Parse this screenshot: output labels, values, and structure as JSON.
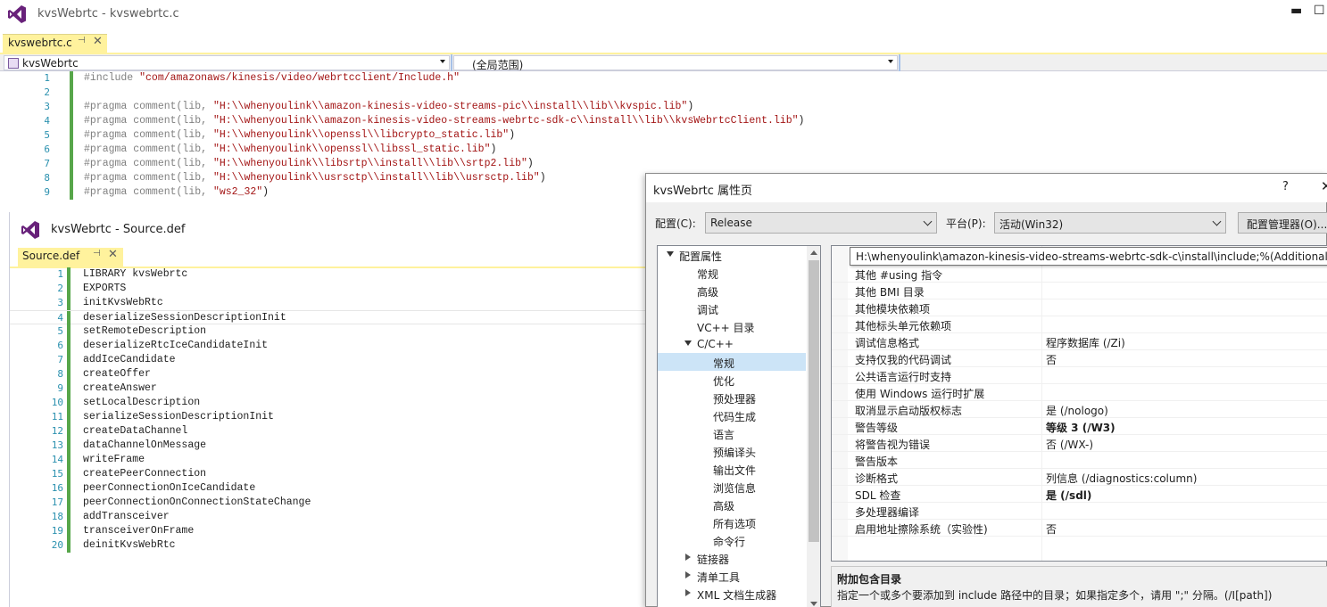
{
  "main_window": {
    "title": "kvsWebrtc - kvswebrtc.c",
    "tab_label": "kvswebrtc.c",
    "pin_glyph": "⊣",
    "close_glyph": "✕",
    "minimize_glyph": "▬",
    "maximize_glyph": "☐",
    "nav_project": "kvsWebrtc",
    "nav_scope": "(全局范围)"
  },
  "editor": {
    "lines": [
      {
        "n": "1",
        "pre": "#include ",
        "str": "\"com/amazonaws/kinesis/video/webrtcclient/Include.h\"",
        "post": ""
      },
      {
        "n": "2",
        "pre": "",
        "str": "",
        "post": ""
      },
      {
        "n": "3",
        "pre": "#pragma comment(lib, ",
        "str": "\"H:\\\\whenyoulink\\\\amazon-kinesis-video-streams-pic\\\\install\\\\lib\\\\kvspic.lib\"",
        "post": ")"
      },
      {
        "n": "4",
        "pre": "#pragma comment(lib, ",
        "str": "\"H:\\\\whenyoulink\\\\amazon-kinesis-video-streams-webrtc-sdk-c\\\\install\\\\lib\\\\kvsWebrtcClient.lib\"",
        "post": ")"
      },
      {
        "n": "5",
        "pre": "#pragma comment(lib, ",
        "str": "\"H:\\\\whenyoulink\\\\openssl\\\\libcrypto_static.lib\"",
        "post": ")"
      },
      {
        "n": "6",
        "pre": "#pragma comment(lib, ",
        "str": "\"H:\\\\whenyoulink\\\\openssl\\\\libssl_static.lib\"",
        "post": ")"
      },
      {
        "n": "7",
        "pre": "#pragma comment(lib, ",
        "str": "\"H:\\\\whenyoulink\\\\libsrtp\\\\install\\\\lib\\\\srtp2.lib\"",
        "post": ")"
      },
      {
        "n": "8",
        "pre": "#pragma comment(lib, ",
        "str": "\"H:\\\\whenyoulink\\\\usrsctp\\\\install\\\\lib\\\\usrsctp.lib\"",
        "post": ")"
      },
      {
        "n": "9",
        "pre": "#pragma comment(lib, ",
        "str": "\"ws2_32\"",
        "post": ")"
      }
    ]
  },
  "def_window": {
    "title": "kvsWebrtc - Source.def",
    "tab_label": "Source.def",
    "pin_glyph": "⊣",
    "close_glyph": "✕",
    "lines": [
      {
        "n": "1",
        "text": "LIBRARY kvsWebrtc"
      },
      {
        "n": "2",
        "text": "EXPORTS"
      },
      {
        "n": "3",
        "text": "initKvsWebRtc"
      },
      {
        "n": "4",
        "text": "deserializeSessionDescriptionInit"
      },
      {
        "n": "5",
        "text": "setRemoteDescription"
      },
      {
        "n": "6",
        "text": "deserializeRtcIceCandidateInit"
      },
      {
        "n": "7",
        "text": "addIceCandidate"
      },
      {
        "n": "8",
        "text": "createOffer"
      },
      {
        "n": "9",
        "text": "createAnswer"
      },
      {
        "n": "10",
        "text": "setLocalDescription"
      },
      {
        "n": "11",
        "text": "serializeSessionDescriptionInit"
      },
      {
        "n": "12",
        "text": "createDataChannel"
      },
      {
        "n": "13",
        "text": "dataChannelOnMessage"
      },
      {
        "n": "14",
        "text": "writeFrame"
      },
      {
        "n": "15",
        "text": "createPeerConnection"
      },
      {
        "n": "16",
        "text": "peerConnectionOnIceCandidate"
      },
      {
        "n": "17",
        "text": "peerConnectionOnConnectionStateChange"
      },
      {
        "n": "18",
        "text": "addTransceiver"
      },
      {
        "n": "19",
        "text": "transceiverOnFrame"
      },
      {
        "n": "20",
        "text": "deinitKvsWebRtc"
      }
    ]
  },
  "dialog": {
    "title": "kvsWebrtc 属性页",
    "help_glyph": "?",
    "close_glyph": "✕",
    "config_label": "配置(C):",
    "config_value": "Release",
    "platform_label": "平台(P):",
    "platform_value": "活动(Win32)",
    "config_manager_button": "配置管理器(O)...",
    "tree": [
      {
        "text": "配置属性",
        "expander": "open"
      },
      {
        "text": "常规",
        "expander": ""
      },
      {
        "text": "高级",
        "expander": ""
      },
      {
        "text": "调试",
        "expander": ""
      },
      {
        "text": "VC++ 目录",
        "expander": ""
      },
      {
        "text": "C/C++",
        "expander": "open"
      },
      {
        "text": "常规",
        "expander": "",
        "selected": true
      },
      {
        "text": "优化",
        "expander": ""
      },
      {
        "text": "预处理器",
        "expander": ""
      },
      {
        "text": "代码生成",
        "expander": ""
      },
      {
        "text": "语言",
        "expander": ""
      },
      {
        "text": "预编译头",
        "expander": ""
      },
      {
        "text": "输出文件",
        "expander": ""
      },
      {
        "text": "浏览信息",
        "expander": ""
      },
      {
        "text": "高级",
        "expander": ""
      },
      {
        "text": "所有选项",
        "expander": ""
      },
      {
        "text": "命令行",
        "expander": ""
      },
      {
        "text": "链接器",
        "expander": "closed"
      },
      {
        "text": "清单工具",
        "expander": "closed"
      },
      {
        "text": "XML 文档生成器",
        "expander": "closed"
      }
    ],
    "tooltip": "H:\\whenyoulink\\amazon-kinesis-video-streams-webrtc-sdk-c\\install\\include;%(AdditionalInc",
    "properties": [
      {
        "key": "其他 #using 指令",
        "value": "",
        "bold": false
      },
      {
        "key": "其他 BMI 目录",
        "value": "",
        "bold": false
      },
      {
        "key": "其他模块依赖项",
        "value": "",
        "bold": false
      },
      {
        "key": "其他标头单元依赖项",
        "value": "",
        "bold": false
      },
      {
        "key": "调试信息格式",
        "value": "程序数据库 (/Zi)",
        "bold": false
      },
      {
        "key": "支持仅我的代码调试",
        "value": "否",
        "bold": false
      },
      {
        "key": "公共语言运行时支持",
        "value": "",
        "bold": false
      },
      {
        "key": "使用 Windows 运行时扩展",
        "value": "",
        "bold": false
      },
      {
        "key": "取消显示启动版权标志",
        "value": "是 (/nologo)",
        "bold": false
      },
      {
        "key": "警告等级",
        "value": "等级 3 (/W3)",
        "bold": true
      },
      {
        "key": "将警告视为错误",
        "value": "否 (/WX-)",
        "bold": false
      },
      {
        "key": "警告版本",
        "value": "",
        "bold": false
      },
      {
        "key": "诊断格式",
        "value": "列信息 (/diagnostics:column)",
        "bold": false
      },
      {
        "key": "SDL 检查",
        "value": "是 (/sdl)",
        "bold": true
      },
      {
        "key": "多处理器编译",
        "value": "",
        "bold": false
      },
      {
        "key": "启用地址擦除系统（实验性)",
        "value": "否",
        "bold": false
      }
    ],
    "description_title": "附加包含目录",
    "description_text": "指定一个或多个要添加到 include 路径中的目录；如果指定多个，请用 \";\" 分隔。(/I[path])"
  },
  "colors": {
    "tab_accent": "#fff29d",
    "line_number": "#2b91af",
    "string": "#a31515",
    "preprocessor": "#808080",
    "change_bar": "#57a64a",
    "selection": "#cce4f7"
  }
}
